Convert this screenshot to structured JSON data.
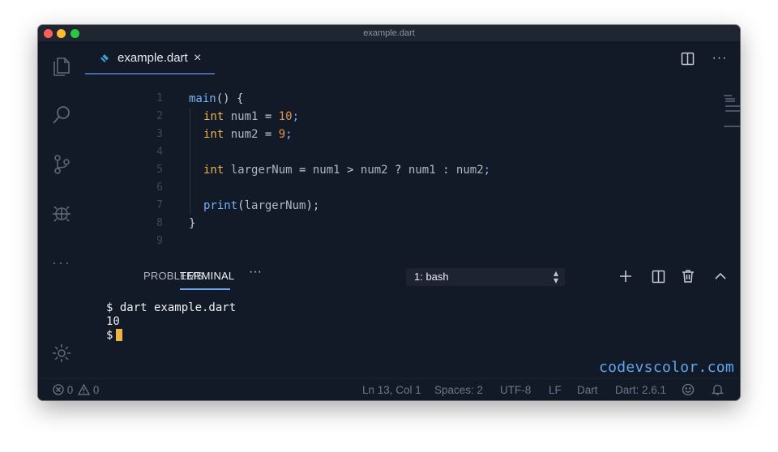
{
  "window": {
    "title": "example.dart"
  },
  "activity_bar": {
    "icons": [
      "files-icon",
      "search-icon",
      "source-control-icon",
      "debug-icon",
      "more-icon",
      "settings-gear-icon"
    ]
  },
  "editor": {
    "tab": {
      "label": "example.dart",
      "close": "×"
    },
    "actions": [
      "split-editor-icon",
      "more-actions-icon"
    ],
    "lines": [
      {
        "n": "1",
        "parts": [
          [
            "fn",
            "main"
          ],
          [
            "pun",
            "() {"
          ]
        ]
      },
      {
        "n": "2",
        "parts": [
          [
            "kw",
            "int"
          ],
          [
            "var",
            " num1 "
          ],
          [
            "pun",
            "= "
          ],
          [
            "num",
            "10"
          ],
          [
            "semi",
            ";"
          ]
        ]
      },
      {
        "n": "3",
        "parts": [
          [
            "kw",
            "int"
          ],
          [
            "var",
            " num2 "
          ],
          [
            "pun",
            "= "
          ],
          [
            "num",
            "9"
          ],
          [
            "semi",
            ";"
          ]
        ]
      },
      {
        "n": "4",
        "parts": []
      },
      {
        "n": "5",
        "parts": [
          [
            "kw",
            "int"
          ],
          [
            "var",
            " largerNum "
          ],
          [
            "pun",
            "= "
          ],
          [
            "var",
            "num1 "
          ],
          [
            "pun",
            "> "
          ],
          [
            "var",
            "num2 "
          ],
          [
            "pun",
            "? "
          ],
          [
            "var",
            "num1 "
          ],
          [
            "pun",
            ": "
          ],
          [
            "var",
            "num2"
          ],
          [
            "semi",
            ";"
          ]
        ]
      },
      {
        "n": "6",
        "parts": []
      },
      {
        "n": "7",
        "parts": [
          [
            "fn",
            "print"
          ],
          [
            "pun",
            "("
          ],
          [
            "var",
            "largerNum"
          ],
          [
            "pun",
            ");"
          ]
        ]
      },
      {
        "n": "8",
        "parts": [
          [
            "pun",
            "}"
          ]
        ]
      },
      {
        "n": "9",
        "parts": []
      }
    ]
  },
  "panel": {
    "tabs": [
      "PROBLEMS",
      "TERMINAL"
    ],
    "active_tab": "TERMINAL",
    "more": "···",
    "terminal_select": {
      "value": "1: bash",
      "arrows": "▴▾"
    },
    "terminal_lines": [
      "$ dart example.dart",
      "10",
      "$"
    ]
  },
  "watermark": "codevscolor.com",
  "status_bar": {
    "errors": "0",
    "warnings": "0",
    "position": "Ln 13, Col 1",
    "spaces": "Spaces: 2",
    "encoding": "UTF-8",
    "eol": "LF",
    "language": "Dart",
    "sdk": "Dart: 2.6.1"
  },
  "colors": {
    "background": "#131a27",
    "keyword": "#ecb34c",
    "function": "#77b2f2",
    "number": "#e6904f",
    "cursor": "#f0b33e"
  }
}
